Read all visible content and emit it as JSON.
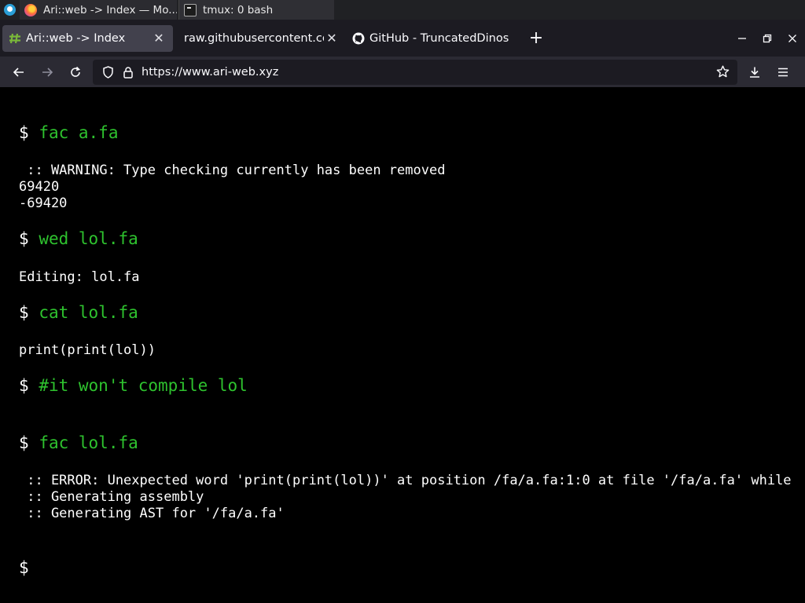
{
  "taskbar": {
    "tasks": [
      {
        "label": "Ari::web -> Index — Mo..."
      },
      {
        "label": "tmux: 0 bash"
      }
    ]
  },
  "browser": {
    "tabs": [
      {
        "label": "Ari::web -> Index",
        "active": true
      },
      {
        "label": "raw.githubusercontent.com/"
      },
      {
        "label": "GitHub - TruncatedDinos"
      }
    ],
    "new_tab_label": "+",
    "url": "https://www.ari-web.xyz"
  },
  "terminal": {
    "prompt": "$",
    "lines": [
      {
        "kind": "cmd",
        "text": "fac a.fa"
      },
      {
        "kind": "out",
        "text": " :: WARNING: Type checking currently has been removed"
      },
      {
        "kind": "out",
        "text": "69420"
      },
      {
        "kind": "out",
        "text": "-69420"
      },
      {
        "kind": "cmd",
        "text": "wed lol.fa"
      },
      {
        "kind": "out",
        "text": "Editing: lol.fa"
      },
      {
        "kind": "cmd",
        "text": "cat lol.fa"
      },
      {
        "kind": "out",
        "text": "print(print(lol))"
      },
      {
        "kind": "cmd",
        "text": "#it won't compile lol"
      },
      {
        "kind": "cmd",
        "text": "fac lol.fa"
      },
      {
        "kind": "out",
        "text": " :: ERROR: Unexpected word 'print(print(lol))' at position /fa/a.fa:1:0 at file '/fa/a.fa' while"
      },
      {
        "kind": "out",
        "text": " :: Generating assembly"
      },
      {
        "kind": "out",
        "text": " :: Generating AST for '/fa/a.fa'"
      },
      {
        "kind": "cmd",
        "text": ""
      }
    ]
  },
  "colors": {
    "command_text": "#2ec22e",
    "terminal_bg": "#000000",
    "tab_active_bg": "#42414d"
  }
}
